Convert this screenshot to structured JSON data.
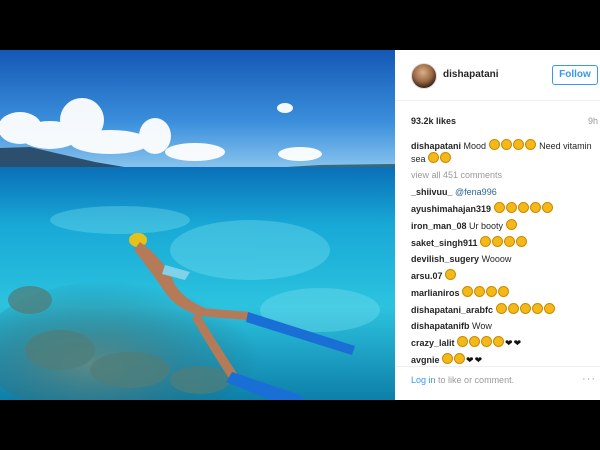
{
  "header": {
    "username": "dishapatani",
    "follow_label": "Follow"
  },
  "post": {
    "likes": "93.2k likes",
    "time": "9h"
  },
  "caption": {
    "user": "dishapatani",
    "text": "Mood",
    "text2": "Need vitamin sea"
  },
  "view_all": "view all 451 comments",
  "comments": [
    {
      "user": "_shiivuu_",
      "text": "@fena996"
    },
    {
      "user": "ayushimahajan319",
      "text": ""
    },
    {
      "user": "iron_man_08",
      "text": "Ur booty"
    },
    {
      "user": "saket_singh911",
      "text": ""
    },
    {
      "user": "devilish_sugery",
      "text": "Wooow"
    },
    {
      "user": "arsu.07",
      "text": ""
    },
    {
      "user": "marlianiros",
      "text": ""
    },
    {
      "user": "dishapatani_arabfc",
      "text": ""
    },
    {
      "user": "dishapatanifb",
      "text": "Wow"
    },
    {
      "user": "crazy_lalit",
      "text": ""
    },
    {
      "user": "avgnie",
      "text": ""
    }
  ],
  "footer": {
    "login_link": "Log in",
    "login_text": "to like or comment.",
    "more": "···"
  },
  "icons": {
    "avatar": "profile-avatar",
    "more": "more-options-icon",
    "emoji": "emoji-face"
  },
  "colors": {
    "follow": "#3897f0",
    "sea": "#1fb4d8",
    "sky": "#1d6fc4"
  }
}
